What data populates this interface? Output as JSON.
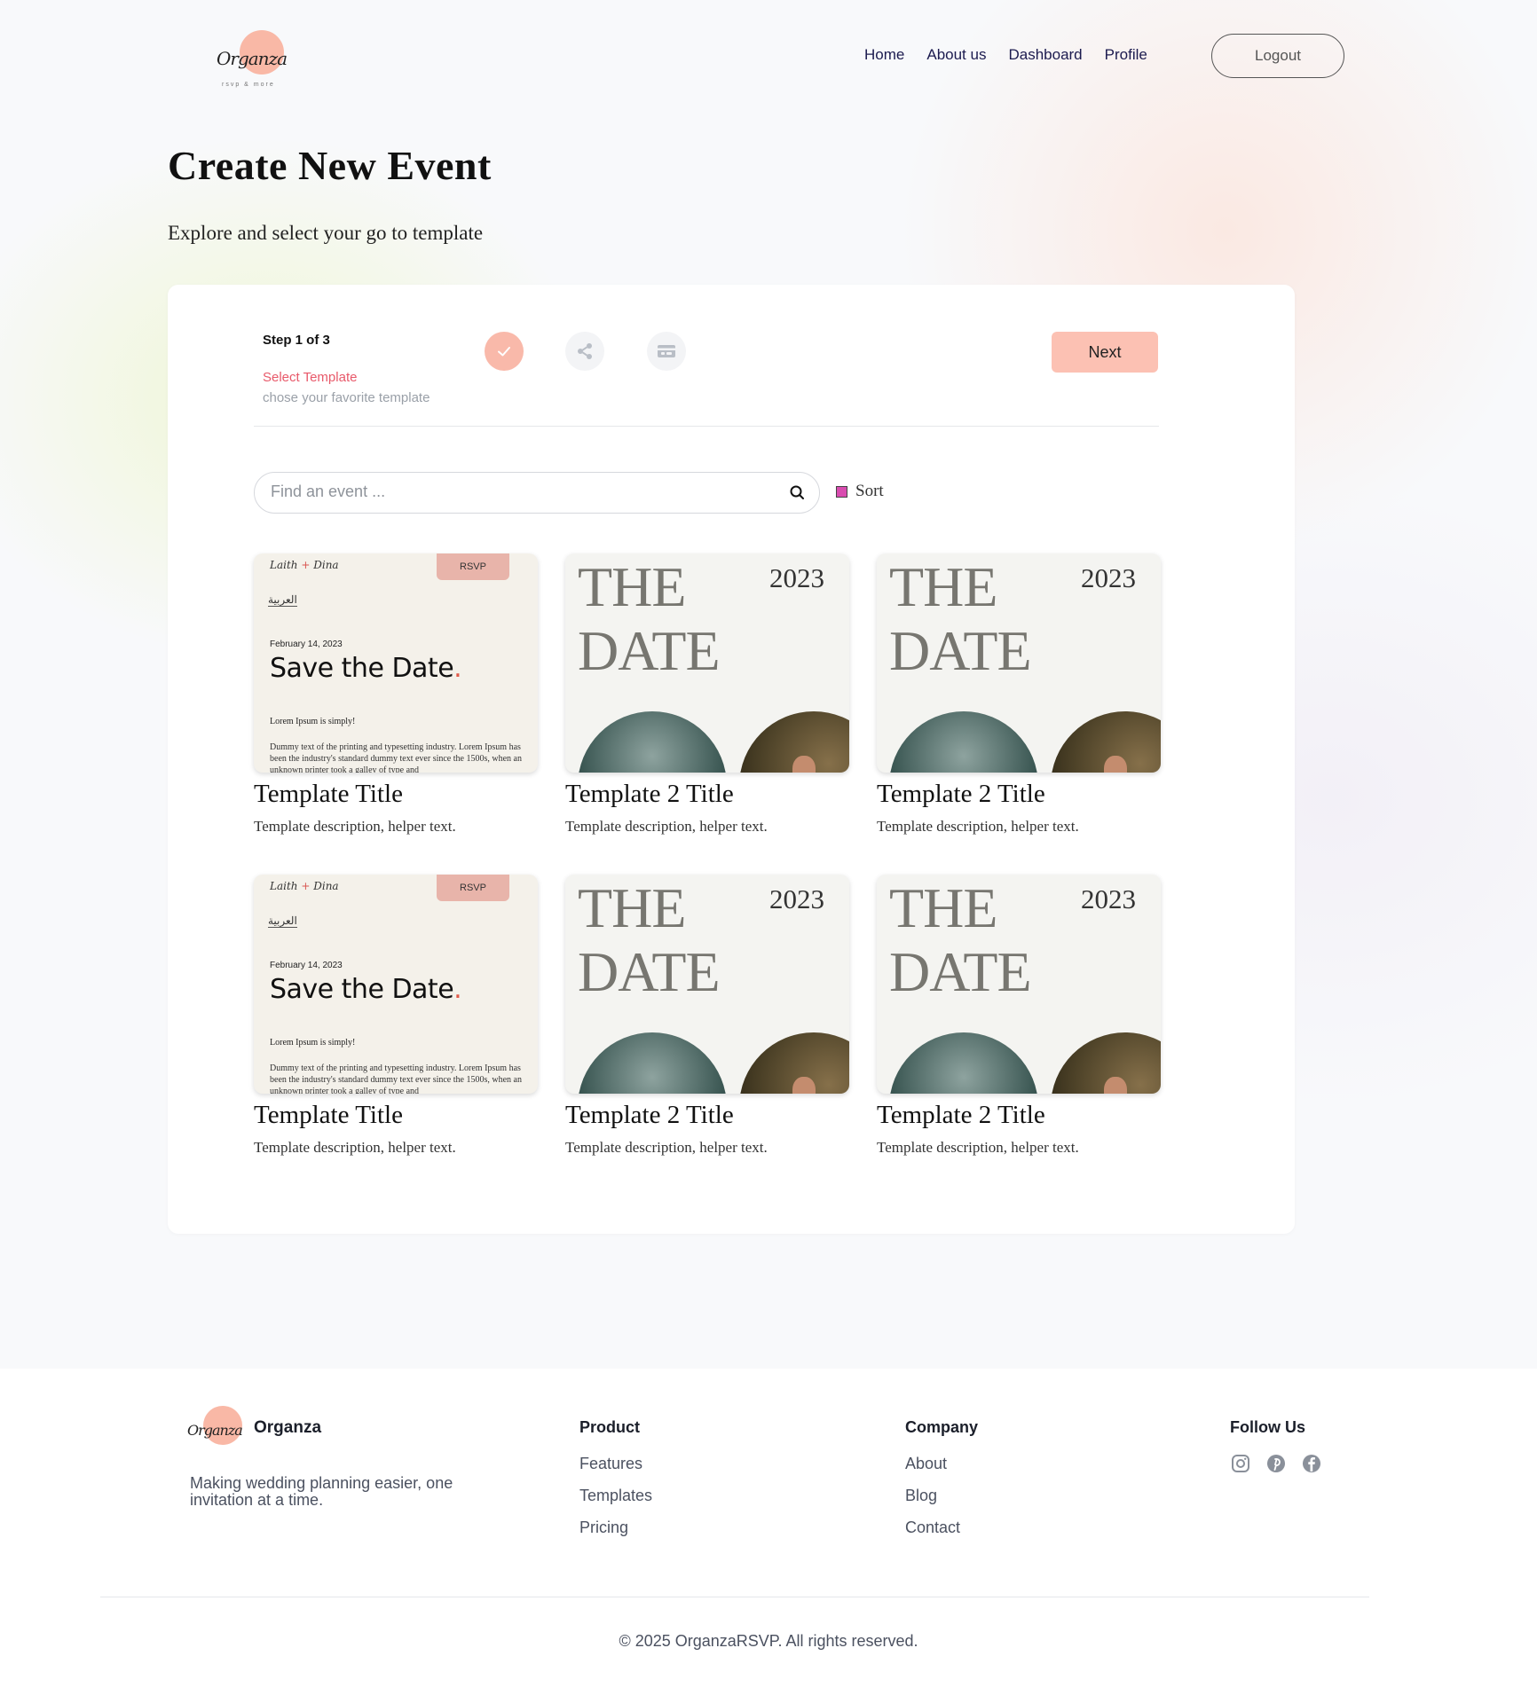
{
  "header": {
    "logo_script": "Organza",
    "logo_tagline": "rsvp & more",
    "nav": [
      "Home",
      "About us",
      "Dashboard",
      "Profile"
    ],
    "logout_label": "Logout"
  },
  "page": {
    "title": "Create New Event",
    "subtitle": "Explore and select your go to template"
  },
  "stepper": {
    "label": "Step 1 of 3",
    "title": "Select Template",
    "description": "chose your favorite template",
    "icons": [
      "check-icon",
      "share-icon",
      "ticket-icon"
    ],
    "next_label": "Next"
  },
  "search": {
    "placeholder": "Find an event ...",
    "sort_label": "Sort"
  },
  "templates": [
    {
      "title": "Template Title",
      "description": "Template description, helper text.",
      "style": "save-the-date"
    },
    {
      "title": "Template 2 Title",
      "description": "Template description, helper text.",
      "style": "the-date"
    },
    {
      "title": "Template 2 Title",
      "description": "Template description, helper text.",
      "style": "the-date"
    },
    {
      "title": "Template Title",
      "description": "Template description, helper text.",
      "style": "save-the-date"
    },
    {
      "title": "Template 2 Title",
      "description": "Template description, helper text.",
      "style": "the-date"
    },
    {
      "title": "Template 2 Title",
      "description": "Template description, helper text.",
      "style": "the-date"
    }
  ],
  "thumb_std": {
    "names_a": "Laith",
    "plus": "+",
    "names_b": "Dina",
    "rsvp": "RSVP",
    "lang": "العربية",
    "date": "February 14, 2023",
    "save": "Save the Date",
    "dot": ".",
    "lorem": "Lorem Ipsum is simply!",
    "dummy": "Dummy text of the printing and typesetting industry. Lorem Ipsum has been the industry's standard dummy text ever since the 1500s, when an unknown printer took a galley of type and"
  },
  "thumb_dt": {
    "the": "THE",
    "date": "DATE",
    "year": "2023"
  },
  "footer": {
    "brand": "Organza",
    "tagline": "Making wedding planning easier, one invitation at a time.",
    "product": {
      "heading": "Product",
      "links": [
        "Features",
        "Templates",
        "Pricing"
      ]
    },
    "company": {
      "heading": "Company",
      "links": [
        "About",
        "Blog",
        "Contact"
      ]
    },
    "follow": {
      "heading": "Follow Us",
      "icons": [
        "instagram-icon",
        "pinterest-icon",
        "facebook-icon"
      ]
    },
    "copyright": "© 2025 OrganzaRSVP. All rights reserved."
  },
  "colors": {
    "accent": "#fcc1b3",
    "step_active": "#e8596a",
    "nav": "#1c1b4f"
  }
}
